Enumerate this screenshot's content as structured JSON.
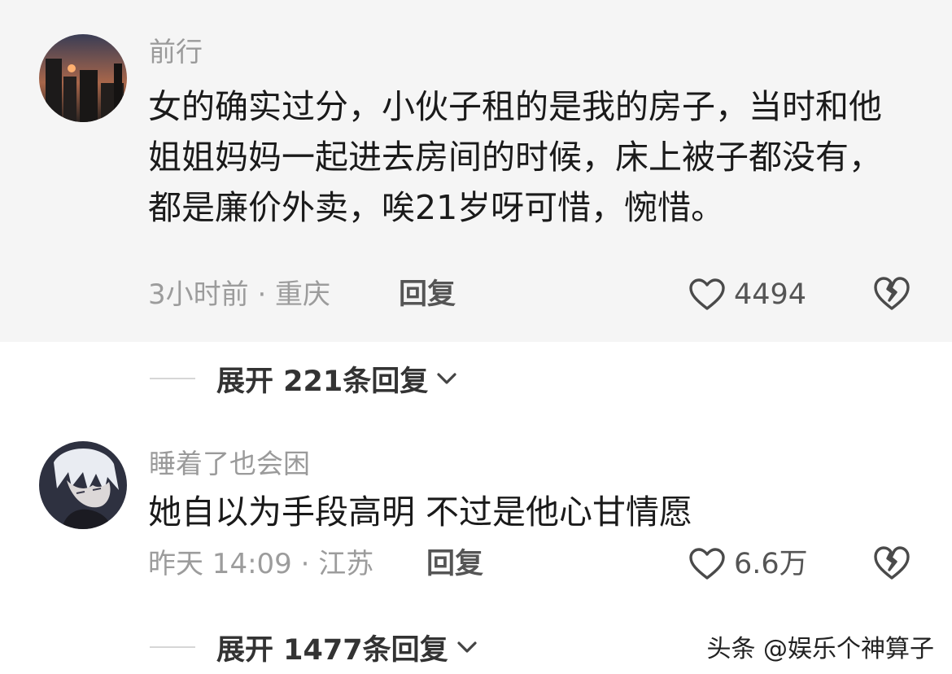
{
  "comments": [
    {
      "username": "前行",
      "text": "女的确实过分，小伙子租的是我的房子，当时和他姐姐妈妈一起进去房间的时候，床上被子都没有，都是廉价外卖，唉21岁呀可惜，惋惜。",
      "meta": "3小时前 · 重庆",
      "reply_label": "回复",
      "likes": "4494",
      "expand_label": "展开 221条回复"
    },
    {
      "username": "睡着了也会困",
      "text": "她自以为手段高明 不过是他心甘情愿",
      "meta": "昨天 14:09 · 江苏",
      "reply_label": "回复",
      "likes": "6.6万",
      "expand_label": "展开 1477条回复"
    }
  ],
  "watermark": "头条 @娱乐个神算子",
  "icons": {
    "like": "heart-outline-icon",
    "dislike": "broken-heart-icon",
    "expand": "chevron-down-icon"
  },
  "colors": {
    "highlight_bg": "#f5f5f5",
    "meta_text": "#9c9c9c",
    "username_text": "#9a9a9a"
  }
}
